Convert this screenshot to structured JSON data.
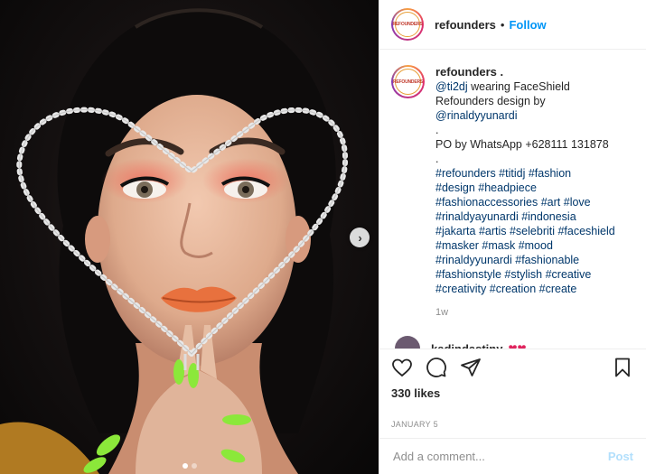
{
  "post": {
    "account": "refounders",
    "avatar_logo": "REFOUNDERS",
    "separator": "•",
    "follow_label": "Follow",
    "caption": {
      "author": "refounders",
      "lines": [
        "@ti2dj wearing FaceShield",
        "Refounders design by",
        "@rinaldyyunardi",
        ".",
        "PO by WhatsApp +628111 131878",
        ".",
        "#refounders #titidj #fashion",
        "#design #headpiece",
        "#fashionaccessories #art #love",
        "#rinaldyayunardi #indonesia",
        "#jakarta #artis #selebriti #faceshield",
        "#masker #mask #mood",
        "#rinaldyyunardi #fashionable",
        "#fashionstyle #stylish #creative",
        "#creativity #creation #create"
      ],
      "age": "1w"
    },
    "next_comment": {
      "author": "kadindastiny",
      "text": "❤❤"
    },
    "likes": "330 likes",
    "date": "JANUARY 5",
    "comment_placeholder": "Add a comment...",
    "post_label": "Post"
  },
  "carousel": {
    "slide_count": 2,
    "active_index": 1,
    "next_icon": "chevron-right-icon"
  },
  "icons": {
    "like": "heart-icon",
    "comment": "comment-icon",
    "share": "paper-plane-icon",
    "save": "bookmark-icon"
  },
  "colors": {
    "link": "#00376b",
    "follow": "#0095f6",
    "post_disabled": "#b2dffc",
    "muted": "#8e8e8e"
  }
}
